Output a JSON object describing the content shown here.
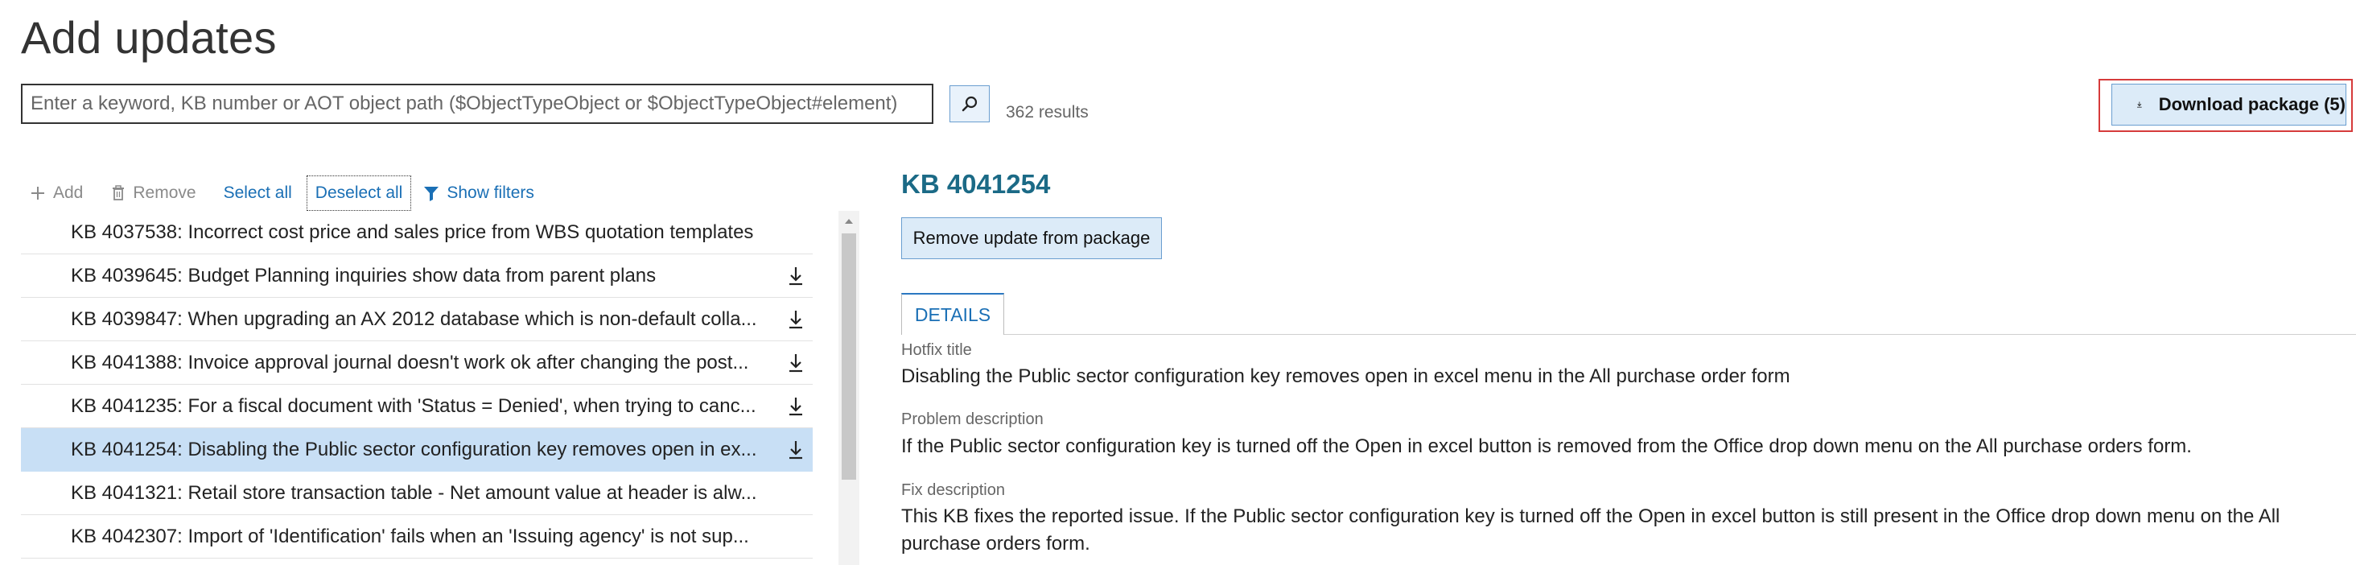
{
  "page": {
    "title": "Add updates"
  },
  "search": {
    "placeholder": "Enter a keyword, KB number or AOT object path ($ObjectTypeObject or $ObjectTypeObject#element)",
    "value": "",
    "results_count": "362 results"
  },
  "download": {
    "label": "Download package (5)"
  },
  "toolbar": {
    "add_label": "Add",
    "remove_label": "Remove",
    "select_all_label": "Select all",
    "deselect_all_label": "Deselect all",
    "show_filters_label": "Show filters"
  },
  "updates": [
    {
      "text": "KB 4037538: Incorrect cost price and sales price from WBS quotation templates",
      "download_icon": false,
      "selected": false
    },
    {
      "text": "KB 4039645: Budget Planning inquiries show data from parent plans",
      "download_icon": true,
      "selected": false
    },
    {
      "text": "KB 4039847: When upgrading an AX 2012 database which is non-default colla...",
      "download_icon": true,
      "selected": false
    },
    {
      "text": "KB 4041388: Invoice approval journal doesn't work ok after changing the post...",
      "download_icon": true,
      "selected": false
    },
    {
      "text": "KB 4041235: For a fiscal document with 'Status = Denied', when trying to canc...",
      "download_icon": true,
      "selected": false
    },
    {
      "text": "KB 4041254: Disabling the Public sector configuration key removes open in ex...",
      "download_icon": true,
      "selected": true
    },
    {
      "text": "KB 4041321: Retail store transaction table - Net amount value at header is alw...",
      "download_icon": false,
      "selected": false
    },
    {
      "text": "KB 4042307: Import of 'Identification' fails when an 'Issuing agency' is not sup...",
      "download_icon": false,
      "selected": false
    }
  ],
  "detail": {
    "kb_title": "KB 4041254",
    "remove_button_label": "Remove update from package",
    "tab_label": "DETAILS",
    "hotfix_title_label": "Hotfix title",
    "hotfix_title": "Disabling the Public sector configuration key removes open in excel menu in the All purchase order form",
    "problem_description_label": "Problem description",
    "problem_description": "If the Public sector configuration key is turned off the Open in excel button is removed from the Office drop down menu on the All purchase orders form.",
    "fix_description_label": "Fix description",
    "fix_description": "This KB fixes the reported issue. If the Public sector configuration key is turned off the Open in excel button is still present in the Office drop down menu on the All purchase orders form."
  },
  "colors": {
    "accent": "#1a6fb5",
    "selected_row": "#c8dff5",
    "button_bg": "#dcebf8",
    "highlight_border": "#d63b3b",
    "kb_title": "#1b6a86"
  },
  "icons": {
    "search_button": "search-icon",
    "download_button": "download-icon",
    "add": "plus-icon",
    "remove": "trash-icon",
    "filters": "filter-icon",
    "row_download": "download-icon"
  }
}
